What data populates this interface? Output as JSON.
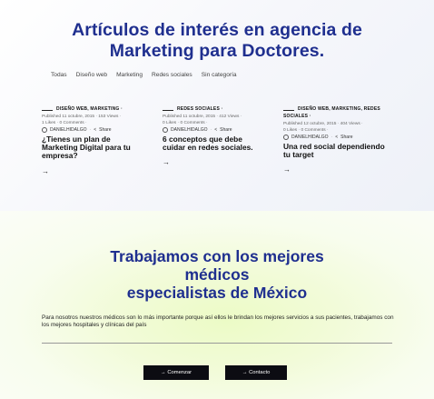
{
  "hero": {
    "title_line1": "Artículos de interés en agencia de",
    "title_line2": "Marketing para Doctores."
  },
  "filters": [
    "Todas",
    "Diseño web",
    "Marketing",
    "Redes sociales",
    "Sin categoría"
  ],
  "posts": [
    {
      "category_line1": "Diseño web, Marketing",
      "category_line2": "",
      "meta_line1": "Published 11 octubre, 2015 · 153 Views ·",
      "meta_line2": "1 Likes · 0 Comments ·",
      "author": "DANIELHIDALGO",
      "share": "Share",
      "title": "¿Tienes un plan de Marketing Digital para tu empresa?",
      "arrow": "→"
    },
    {
      "category_line1": "Redes sociales",
      "category_line2": "",
      "meta_line1": "Published 11 octubre, 2015 · 412 Views ·",
      "meta_line2": "0 Likes · 0 Comments ·",
      "author": "DANIELHIDALGO",
      "share": "Share",
      "title": "6 conceptos que debe cuidar en redes sociales.",
      "arrow": "→"
    },
    {
      "category_line1": "Diseño web, Marketing, Redes",
      "category_line2": "sociales",
      "meta_line1": "Published 12 octubre, 2015 · 404 Views ·",
      "meta_line2": "0 Likes · 0 Comments ·",
      "author": "DANIELHIDALGO",
      "share": "Share",
      "title": "Una red social dependiendo tu target",
      "arrow": "→"
    }
  ],
  "section2": {
    "title_line1": "Trabajamos con los mejores",
    "title_line2": "médicos",
    "title_line3": "especialistas de México",
    "paragraph": "Para nosotros nuestros médicos son lo más importante porque así ellos le brindan los mejores servicios a sus pacientes, trabajamos con los mejores hospitales y clínicas del país",
    "btn_start": "→ Comenzar",
    "btn_contact": "→ Contacto"
  },
  "colors": {
    "heading": "#1f2f8f",
    "button": "#0c0c12",
    "accent_glow": "#ecfbc6"
  }
}
